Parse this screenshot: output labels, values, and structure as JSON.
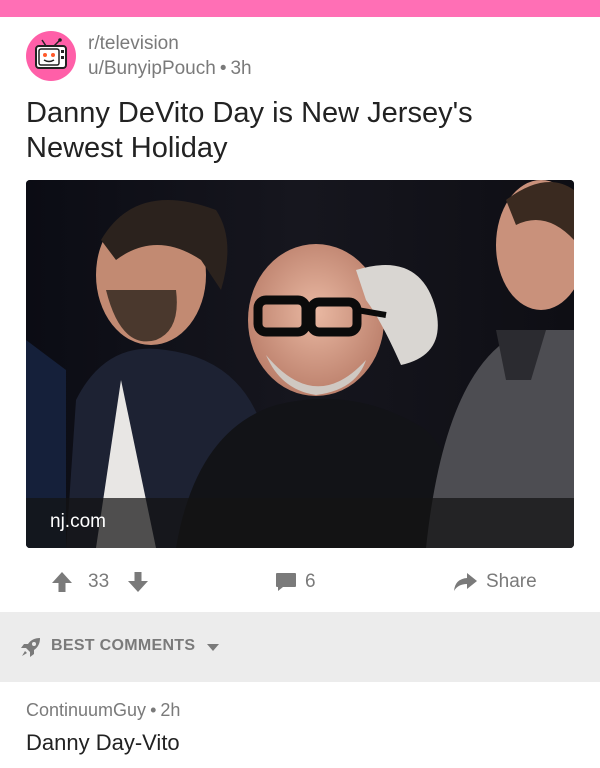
{
  "post": {
    "subreddit": "r/television",
    "author": "u/BunyipPouch",
    "age": "3h",
    "title": "Danny DeVito Day is New Jersey's Newest Holiday",
    "link_domain": "nj.com"
  },
  "actions": {
    "score": "33",
    "comment_count": "6",
    "share_label": "Share"
  },
  "comments_section": {
    "sort_label": "BEST COMMENTS"
  },
  "comments": [
    {
      "author": "ContinuumGuy",
      "age": "2h",
      "body": "Danny Day-Vito"
    }
  ],
  "colors": {
    "top_bar": "#ff6fb5",
    "avatar_bg": "#ff5fa8",
    "muted_text": "#7a7a7a",
    "sort_bar_bg": "#ececec"
  },
  "icons": {
    "upvote": "arrow-up-icon",
    "downvote": "arrow-down-icon",
    "comments": "comment-bubble-icon",
    "share": "share-arrow-icon",
    "sort": "rocket-icon",
    "sort_dropdown": "caret-down-icon",
    "subreddit_avatar": "television-icon"
  }
}
